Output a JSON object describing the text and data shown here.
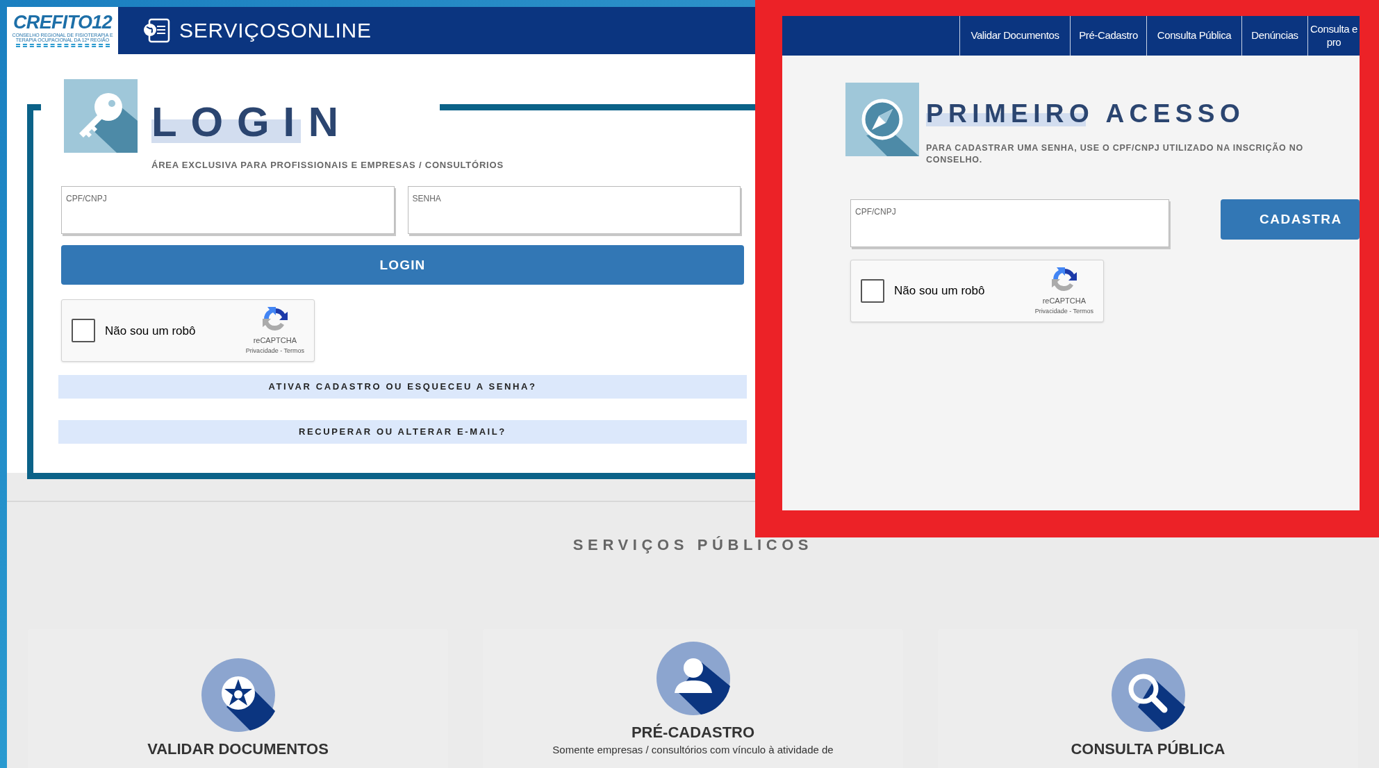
{
  "header": {
    "logo": "CREFITO12",
    "logo_tagline": "CONSELHO REGIONAL DE FISIOTERAPIA E TERAPIA OCUPACIONAL DA 12ª REGIÃO",
    "title": "SERVIÇOSONLINE"
  },
  "login": {
    "title": "LOGIN",
    "subtitle": "ÁREA EXCLUSIVA PARA PROFISSIONAIS E EMPRESAS / CONSULTÓRIOS",
    "fields": [
      {
        "label": "CPF/CNPJ"
      },
      {
        "label": "SENHA"
      }
    ],
    "button": "LOGIN",
    "captcha": {
      "label": "Não sou um robô",
      "checked": false,
      "brand": "reCAPTCHA",
      "links": "Privacidade - Termos"
    },
    "links": [
      "ATIVAR CADASTRO OU ESQUECEU A SENHA?",
      "RECUPERAR OU ALTERAR E-MAIL?"
    ]
  },
  "highlight": {
    "nav": [
      {
        "label": "Validar Documentos"
      },
      {
        "label": "Pré-Cadastro"
      },
      {
        "label": "Consulta Pública"
      },
      {
        "label": "Denúncias"
      },
      {
        "label": "Consulta e pro"
      }
    ],
    "title": "PRIMEIRO ACESSO",
    "subtitle": "PARA CADASTRAR UMA SENHA, USE O CPF/CNPJ UTILIZADO NA INSCRIÇÃO NO CONSELHO.",
    "field": {
      "label": "CPF/CNPJ"
    },
    "button": "CADASTRA",
    "captcha": {
      "label": "Não sou um robô",
      "checked": false,
      "brand": "reCAPTCHA",
      "links": "Privacidade - Termos"
    }
  },
  "services": {
    "title": "SERVIÇOS PÚBLICOS",
    "cards": [
      {
        "kind": "emblem",
        "title": "VALIDAR DOCUMENTOS"
      },
      {
        "kind": "person",
        "title": "PRÉ-CADASTRO",
        "text": "Somente empresas / consultórios com vínculo à atividade de"
      },
      {
        "kind": "search",
        "title": "CONSULTA PÚBLICA"
      }
    ]
  }
}
